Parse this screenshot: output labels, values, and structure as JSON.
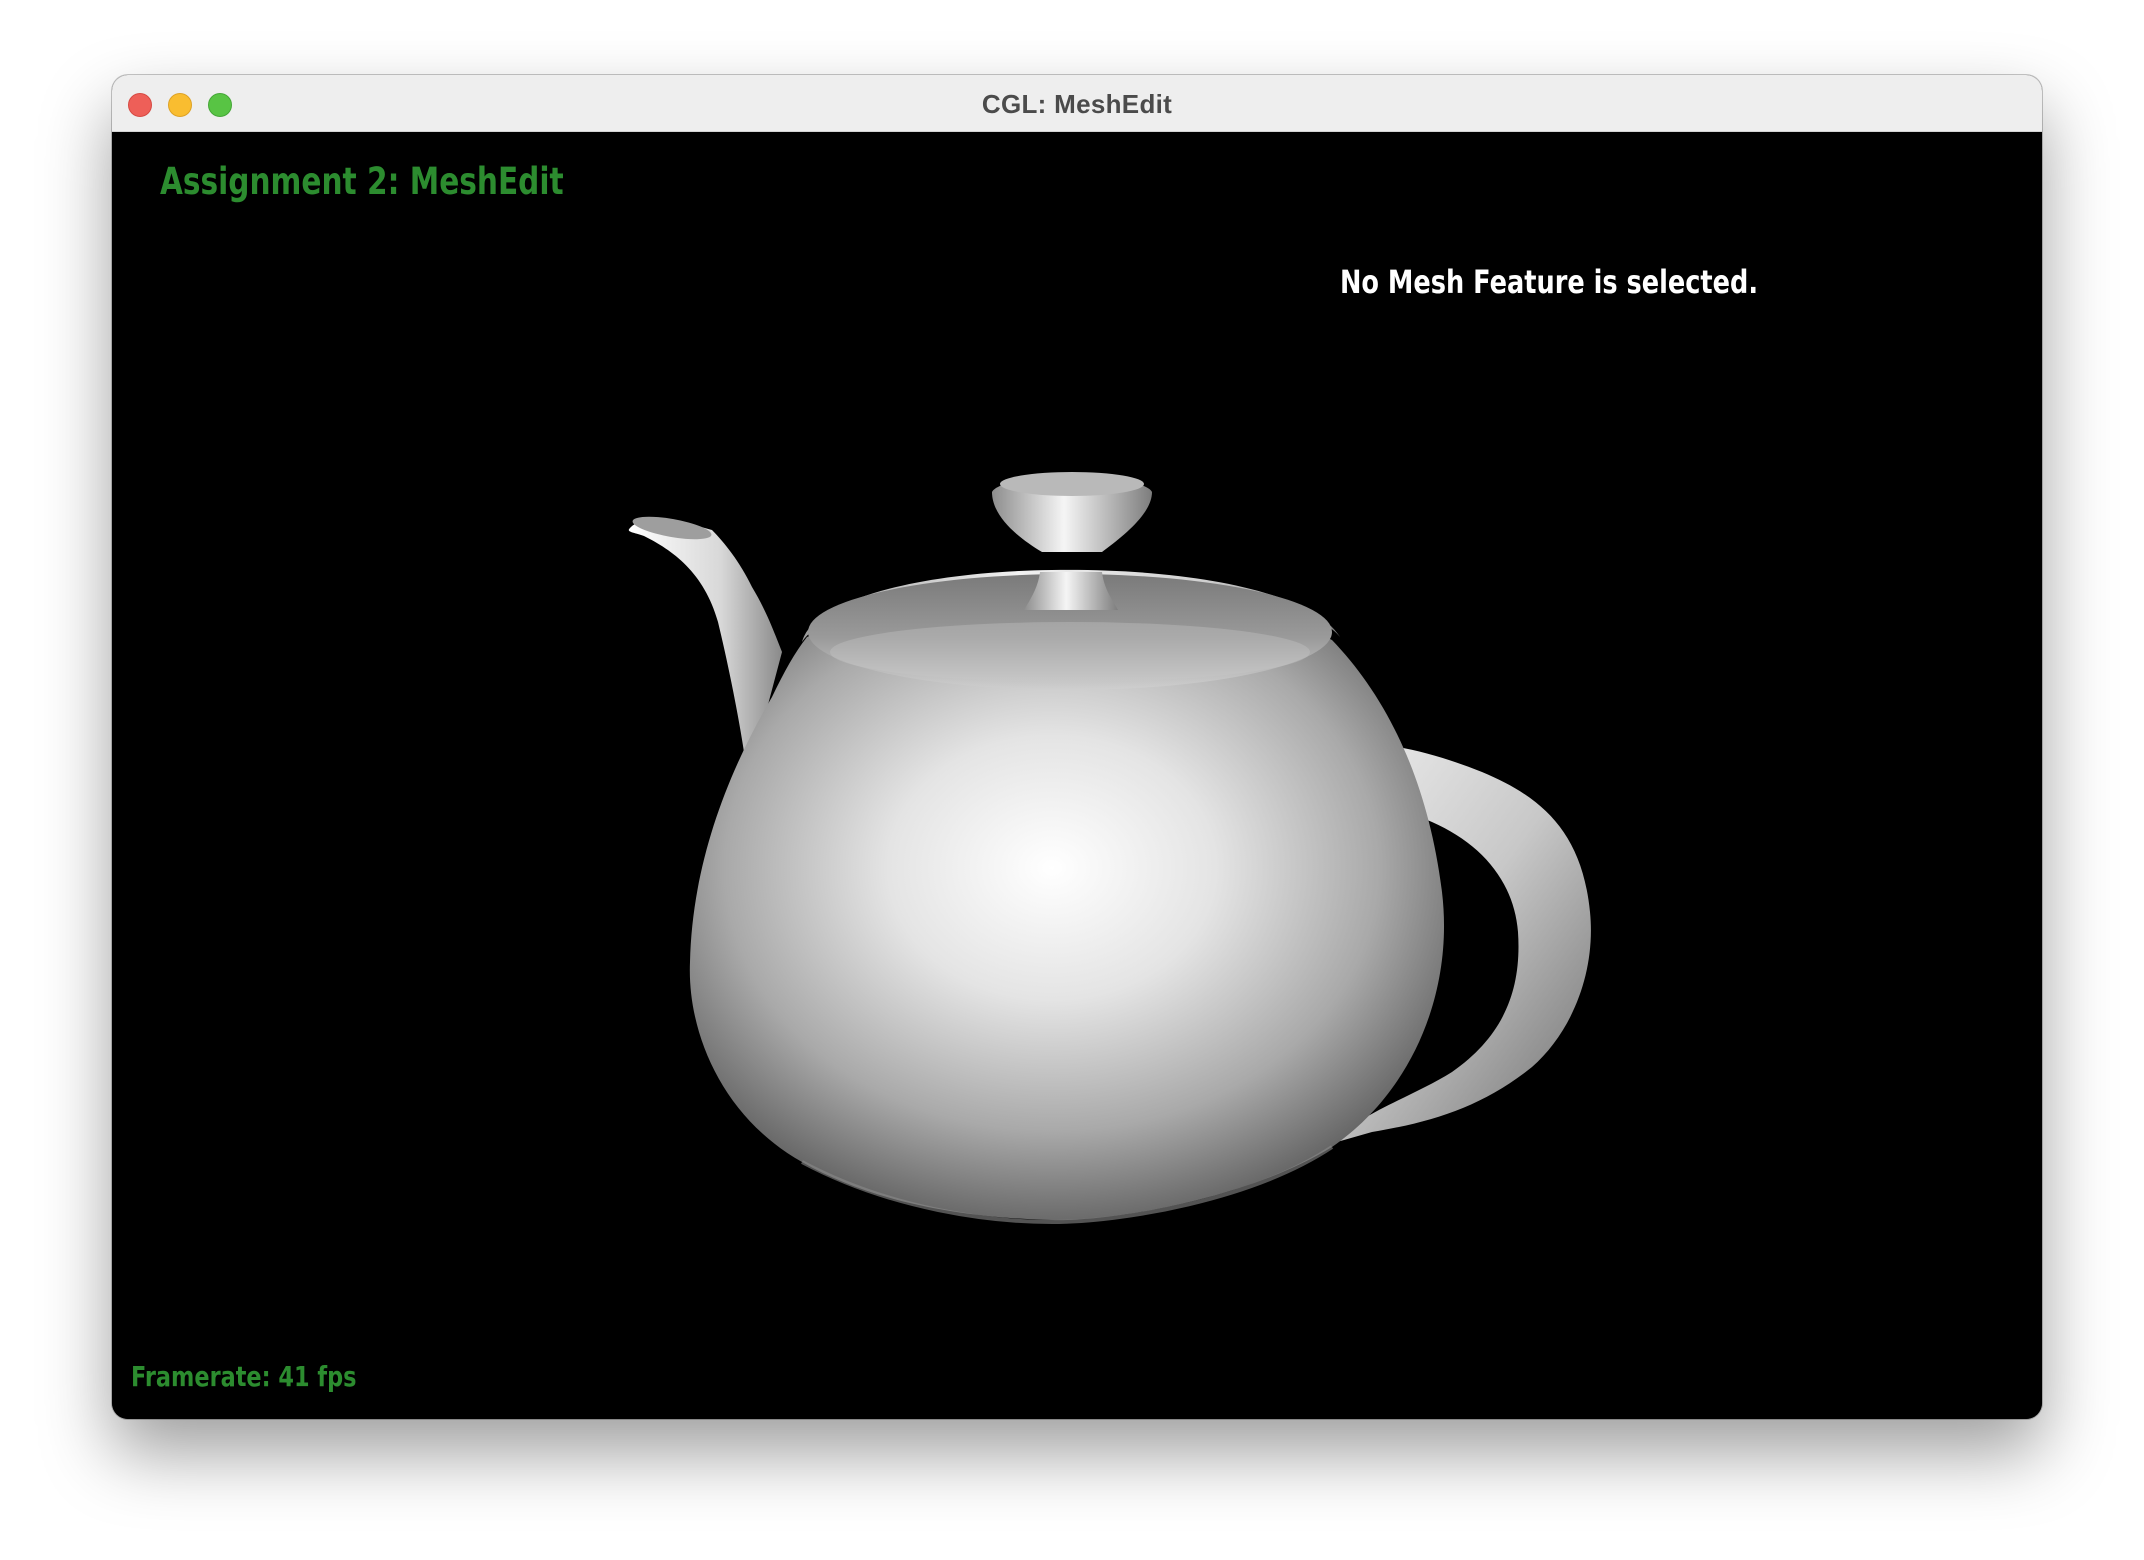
{
  "window": {
    "title": "CGL: MeshEdit"
  },
  "hud": {
    "assignment_title": "Assignment 2: MeshEdit",
    "selection_status": "No Mesh Feature is selected.",
    "framerate": "Framerate: 41 fps"
  },
  "scene": {
    "model": "teapot",
    "background_color": "#000000"
  },
  "colors": {
    "hud_green": "#2c8c2f",
    "hud_white": "#ffffff",
    "close": "#ee5f58",
    "minimize": "#f9bd30",
    "zoom": "#58c444"
  }
}
